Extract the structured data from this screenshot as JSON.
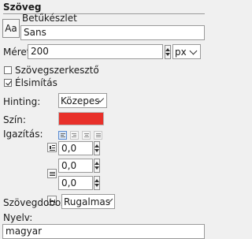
{
  "panel": {
    "title": "Szöveg"
  },
  "font": {
    "button_label": "Aa",
    "label": "Betűkészlet",
    "value": "Sans"
  },
  "size": {
    "label": "Méret:",
    "value": "200",
    "unit": "px"
  },
  "editor": {
    "label": "Szövegszerkesztő",
    "checked": false
  },
  "antialias": {
    "label": "Élsimítás",
    "checked": true
  },
  "hinting": {
    "label": "Hinting:",
    "value": "Közepes"
  },
  "color": {
    "label": "Szín:",
    "value": "#e8302a"
  },
  "justify": {
    "label": "Igazítás:"
  },
  "indent": {
    "value": "0,0"
  },
  "line_spacing": {
    "value": "0,0"
  },
  "letter_spacing": {
    "value": "0,0"
  },
  "box": {
    "label": "Szövegdoboz:",
    "value": "Rugalmas"
  },
  "language": {
    "label": "Nyelv:",
    "value": "magyar"
  }
}
